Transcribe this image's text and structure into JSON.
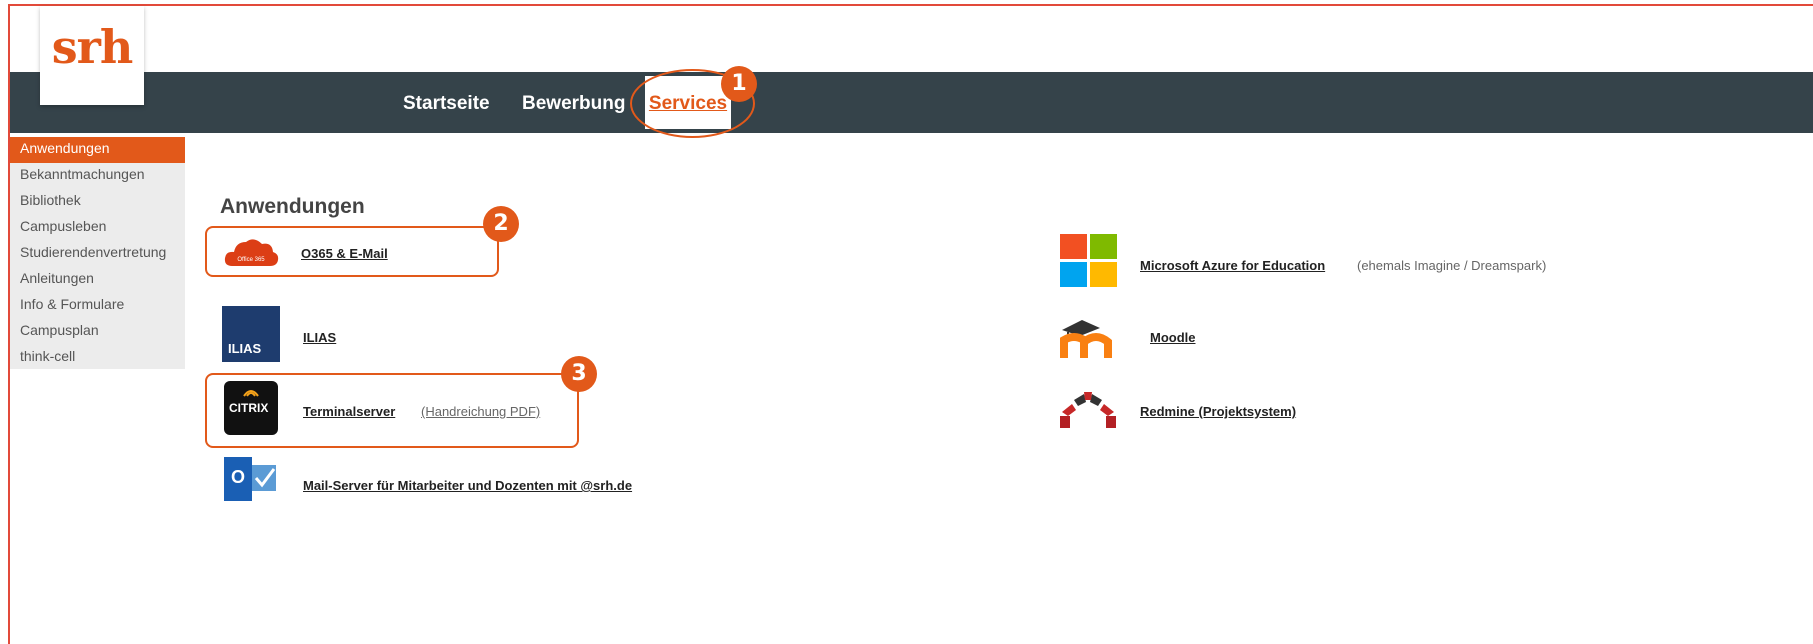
{
  "brand": {
    "logo_text": "srh"
  },
  "nav": {
    "items": [
      "Startseite",
      "Bewerbung"
    ],
    "active": "Services"
  },
  "badges": [
    "1",
    "2",
    "3"
  ],
  "sidebar": {
    "items": [
      "Anwendungen",
      "Bekanntmachungen",
      "Bibliothek",
      "Campusleben",
      "Studierendenvertretung",
      "Anleitungen",
      "Info & Formulare",
      "Campusplan",
      "think-cell"
    ]
  },
  "main": {
    "title": "Anwendungen",
    "apps_left": [
      {
        "icon": "office365-icon",
        "label": "O365 & E-Mail",
        "icon_text": "Office 365"
      },
      {
        "icon": "ilias-icon",
        "label": "ILIAS",
        "icon_text": "ILIAS"
      },
      {
        "icon": "citrix-icon",
        "label": "Terminalserver",
        "icon_text": "CITRIX",
        "note": "(Handreichung PDF)"
      },
      {
        "icon": "outlook-icon",
        "label": "Mail-Server für Mitarbeiter und Dozenten mit @srh.de",
        "icon_text": "O"
      }
    ],
    "apps_right": [
      {
        "icon": "microsoft-logo-icon",
        "label": "Microsoft Azure for Education",
        "note": "(ehemals Imagine / Dreamspark)"
      },
      {
        "icon": "moodle-icon",
        "label": "Moodle"
      },
      {
        "icon": "redmine-icon",
        "label": "Redmine (Projektsystem)"
      }
    ]
  },
  "colors": {
    "accent": "#e2591a",
    "navbar": "#35434a",
    "sidebar": "#ececec"
  }
}
